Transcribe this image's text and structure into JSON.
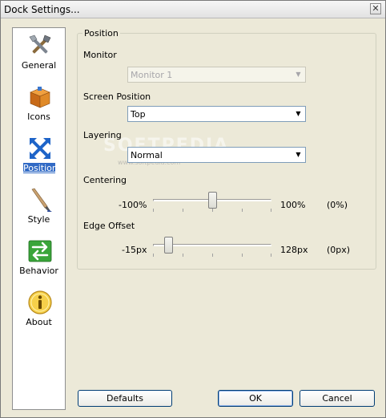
{
  "window": {
    "title": "Dock Settings..."
  },
  "sidebar": {
    "items": [
      {
        "label": "General",
        "icon": "tools-icon"
      },
      {
        "label": "Icons",
        "icon": "box-icon"
      },
      {
        "label": "Position",
        "icon": "move-arrows-icon",
        "selected": true
      },
      {
        "label": "Style",
        "icon": "paintbrush-icon"
      },
      {
        "label": "Behavior",
        "icon": "swap-arrows-icon"
      },
      {
        "label": "About",
        "icon": "info-icon"
      }
    ]
  },
  "position_group": {
    "legend": "Position",
    "monitor": {
      "label": "Monitor",
      "value": "Monitor 1",
      "disabled": true
    },
    "screen_position": {
      "label": "Screen Position",
      "value": "Top"
    },
    "layering": {
      "label": "Layering",
      "value": "Normal"
    },
    "centering": {
      "label": "Centering",
      "min": "-100%",
      "max": "100%",
      "current": "(0%)",
      "fraction": 0.5
    },
    "edge_offset": {
      "label": "Edge Offset",
      "min": "-15px",
      "max": "128px",
      "current": "(0px)",
      "fraction": 0.105
    }
  },
  "buttons": {
    "defaults": "Defaults",
    "ok": "OK",
    "cancel": "Cancel"
  },
  "watermark": {
    "text": "SOFTPEDIA",
    "sub": "www.softpedia.com"
  },
  "colors": {
    "selection": "#316ac5",
    "window_bg": "#ece9d8",
    "field_border": "#7f9db9"
  }
}
